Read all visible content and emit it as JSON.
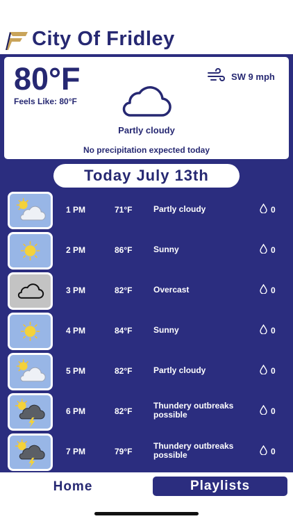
{
  "header": {
    "city_name": "City Of Fridley",
    "logo_icon": "fridley-f-logo-icon"
  },
  "current": {
    "temperature": "80°F",
    "feels_like": "Feels Like: 80°F",
    "wind": "SW 9 mph",
    "condition": "Partly cloudy",
    "precipitation_note": "No precipitation expected today"
  },
  "date_label": "Today July 13th",
  "hourly": [
    {
      "time": "1 PM",
      "temp": "71°F",
      "condition": "Partly cloudy",
      "precip": "0",
      "icon": "partly-cloudy-icon"
    },
    {
      "time": "2 PM",
      "temp": "86°F",
      "condition": "Sunny",
      "precip": "0",
      "icon": "sunny-icon"
    },
    {
      "time": "3 PM",
      "temp": "82°F",
      "condition": "Overcast",
      "precip": "0",
      "icon": "overcast-icon"
    },
    {
      "time": "4 PM",
      "temp": "84°F",
      "condition": "Sunny",
      "precip": "0",
      "icon": "sunny-icon"
    },
    {
      "time": "5 PM",
      "temp": "82°F",
      "condition": "Partly cloudy",
      "precip": "0",
      "icon": "partly-cloudy-icon"
    },
    {
      "time": "6 PM",
      "temp": "82°F",
      "condition": "Thundery outbreaks possible",
      "precip": "0",
      "icon": "thunder-icon"
    },
    {
      "time": "7 PM",
      "temp": "79°F",
      "condition": "Thundery outbreaks possible",
      "precip": "0",
      "icon": "thunder-icon"
    }
  ],
  "nav": {
    "home_label": "Home",
    "playlists_label": "Playlists"
  },
  "colors": {
    "brand_navy": "#2b2d7f",
    "logo_gold": "#c9a45a",
    "sky_tile": "#98b6e6",
    "overcast_tile": "#c3c3c3"
  }
}
